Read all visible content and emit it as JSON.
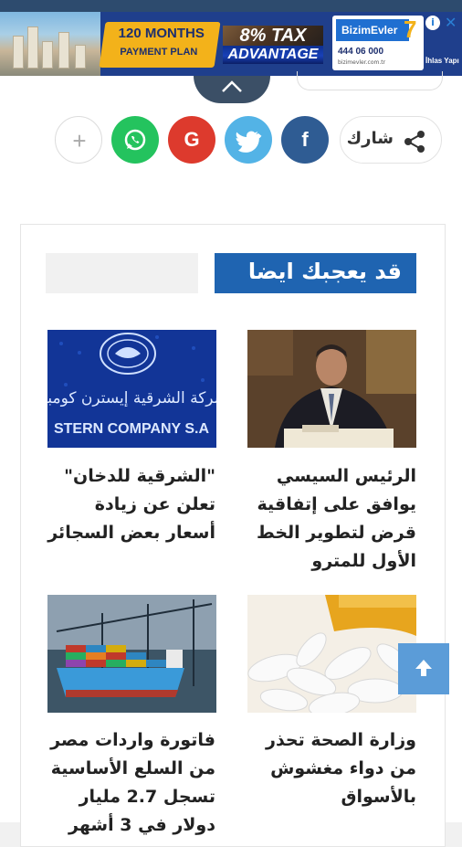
{
  "ad": {
    "badge_line1": "120 MONTHS",
    "badge_line2": "PAYMENT PLAN",
    "tax_line1": "8% TAX",
    "tax_line2": "ADVANTAGE",
    "brand_name": "BizimEvler",
    "brand_number": "7",
    "phone": "444 06 000",
    "url": "bizimevler.com.tr",
    "developer": "İhlas Yapı",
    "info_icon": "i",
    "close_icon": "✕"
  },
  "share": {
    "label": "شارك",
    "buttons": [
      {
        "name": "facebook",
        "glyph": "f",
        "color": "#2f5c93"
      },
      {
        "name": "twitter",
        "glyph": "t",
        "color": "#53b3e6"
      },
      {
        "name": "google",
        "glyph": "G",
        "color": "#dd3a2d"
      },
      {
        "name": "whatsapp",
        "glyph": "w",
        "color": "#24c35e"
      },
      {
        "name": "more",
        "glyph": "+",
        "color": "#ffffff"
      }
    ]
  },
  "related": {
    "title": "قد يعجبك ايضا",
    "articles": [
      {
        "caption": "الرئيس السيسي يوافق على إتفاقية قرض لتطوير الخط الأول للمترو",
        "image": "president-reading-document"
      },
      {
        "caption": "\"الشرقية للدخان\" تعلن عن زيادة أسعار بعض السجائر",
        "image": "eastern-company-logo",
        "image_text_ar": "الشركة الشرقية إيسترن كومباني",
        "image_text_en": "STERN COMPANY S.A"
      },
      {
        "caption": "وزارة الصحة تحذر من دواء مغشوش بالأسواق",
        "image": "medicine-pills"
      },
      {
        "caption": "فاتورة واردات مصر من السلع الأساسية تسجل 2.7 مليار دولار في 3 أشهر",
        "image": "container-ship"
      }
    ]
  },
  "colors": {
    "accent_blue": "#1f64b1",
    "scroll_top": "#5b9cd8"
  }
}
